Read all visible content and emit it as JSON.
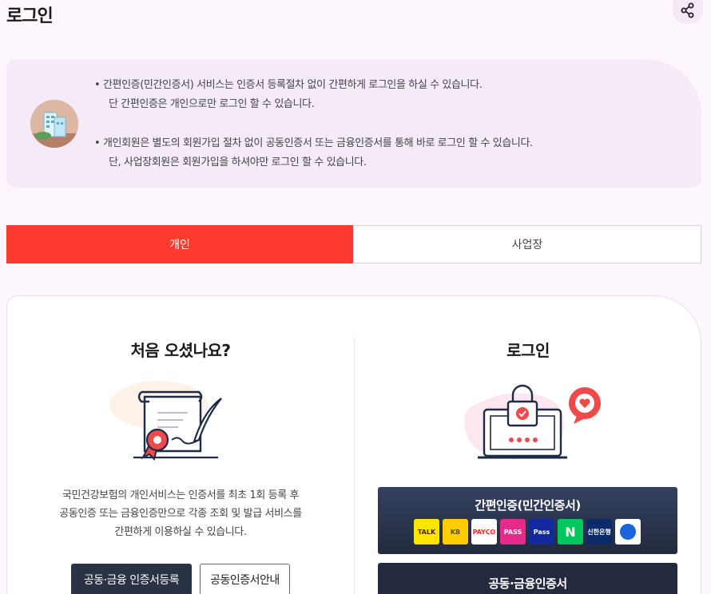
{
  "header": {
    "title": "로그인",
    "share_icon": "share-icon"
  },
  "notice": {
    "avatar_icon": "building-icon",
    "lines": [
      "• 간편인증(민간인증서) 서비스는 인증서 등록절차 없이 간편하게 로그인을 하실 수 있습니다.",
      "  단 간편인증은 개인으로만 로그인 할 수 있습니다.",
      "• 개인회원은 별도의 회원가입 절차 없이 공동인증서 또는 금융인증서를 통해 바로 로그인 할 수 있습니다.",
      "  단, 사업장회원은 회원가입을 하셔야만 로그인 할 수 있습니다."
    ]
  },
  "tabs": [
    {
      "label": "개인",
      "active": true
    },
    {
      "label": "사업장",
      "active": false
    }
  ],
  "colors": {
    "accent": "#ff3a2f",
    "dark_button": "#2a3245",
    "panel_bg": "#ffffff",
    "page_bg": "#fdf7fd"
  },
  "first_visit": {
    "title": "처음 오셨나요?",
    "illustration_icon": "certificate-scroll-icon",
    "description": [
      "국민건강보험의 개인서비스는 인증서를 최초 1회 등록 후",
      "공동인증 또는 금융인증만으로 각종 조회 및 발급 서비스를",
      "간편하게 이용하실 수 있습니다."
    ],
    "register_button": "공동·금융 인증서등록",
    "guide_button": "공동인증서안내"
  },
  "login": {
    "title": "로그인",
    "illustration_icon": "laptop-lock-icon",
    "simple_auth_button": "간편인증(민간인증서)",
    "providers": [
      {
        "name": "kakao-talk",
        "label": "TALK",
        "bg": "#fee500",
        "fg": "#3c1e1e"
      },
      {
        "name": "kb",
        "label": "KB",
        "bg": "#ffcd00",
        "fg": "#5a4a3c"
      },
      {
        "name": "payco",
        "label": "PAYCO",
        "bg": "#ffffff",
        "fg": "#fa2828"
      },
      {
        "name": "pass",
        "label": "PASS",
        "bg": "#e52a8b",
        "fg": "#ffffff"
      },
      {
        "name": "samsung-pass",
        "label": "Pass",
        "bg": "#1428a0",
        "fg": "#ffffff"
      },
      {
        "name": "naver",
        "label": "N",
        "bg": "#03c75a",
        "fg": "#ffffff"
      },
      {
        "name": "shinhan",
        "label": "신한은행",
        "bg": "#0b2b6b",
        "fg": "#ffffff"
      },
      {
        "name": "toss",
        "label": "",
        "bg": "#ffffff",
        "fg": "#1b64da"
      }
    ],
    "joint_cert_button": "공동·금융인증서"
  }
}
